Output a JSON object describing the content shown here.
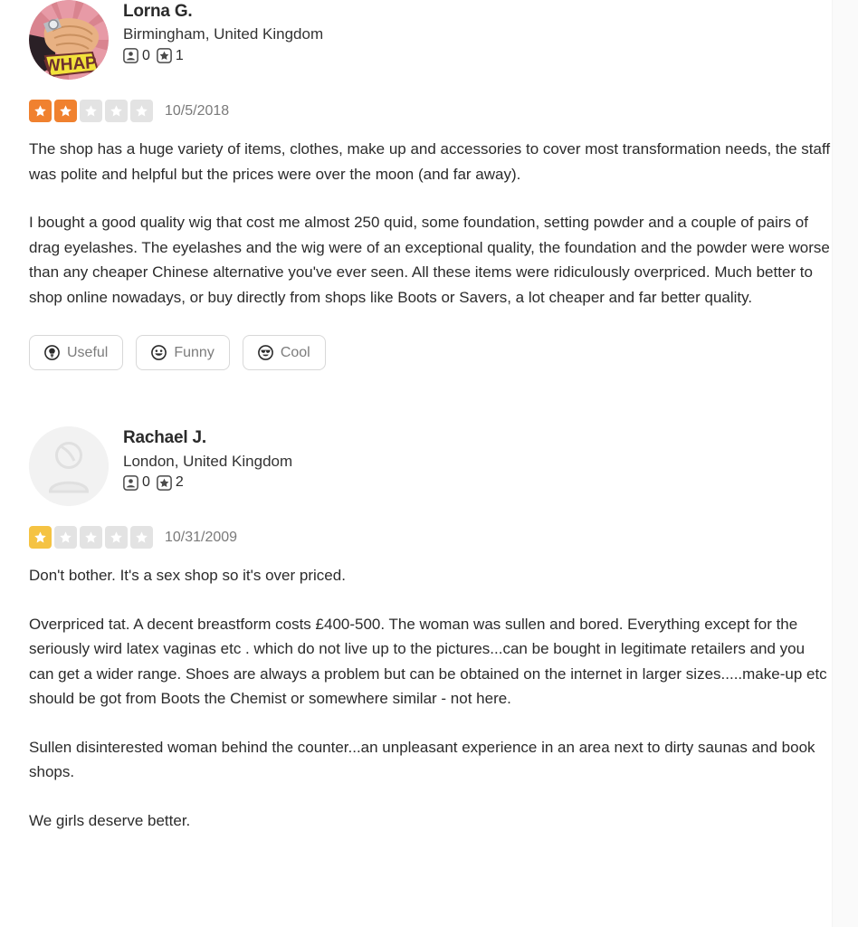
{
  "reviews": [
    {
      "user": {
        "name": "Lorna G.",
        "location": "Birmingham, United Kingdom",
        "friends_icon": "friends-icon",
        "friends_count": "0",
        "reviews_icon": "reviews-star-icon",
        "reviews_count": "1",
        "avatar_type": "photo-whap-comic",
        "avatar_caption": "WHAP"
      },
      "rating": 2,
      "rating_color": "#f0812f",
      "date": "10/5/2018",
      "paragraphs": [
        "The shop has a huge variety of items, clothes, make up and accessories to cover most transformation needs, the staff was polite and helpful but the prices were over the moon (and far away).",
        "I bought a good quality wig that cost me almost 250 quid, some foundation, setting powder and a couple of pairs of drag eyelashes. The eyelashes and the wig were of an exceptional quality, the foundation and the powder were worse than any cheaper Chinese alternative you've ever seen. All these items were ridiculously overpriced. Much better to shop online nowadays, or buy directly from shops like Boots or Savers, a lot cheaper and far better quality."
      ],
      "actions": [
        {
          "label": "Useful",
          "icon": "lightbulb-icon"
        },
        {
          "label": "Funny",
          "icon": "smiley-laugh-icon"
        },
        {
          "label": "Cool",
          "icon": "smiley-sunglasses-icon"
        }
      ]
    },
    {
      "user": {
        "name": "Rachael J.",
        "location": "London, United Kingdom",
        "friends_icon": "friends-icon",
        "friends_count": "0",
        "reviews_icon": "reviews-star-icon",
        "reviews_count": "2",
        "avatar_type": "default-placeholder",
        "avatar_caption": ""
      },
      "rating": 1,
      "rating_color": "#f5c343",
      "date": "10/31/2009",
      "paragraphs": [
        "Don't bother. It's a sex shop so it's over priced.",
        "Overpriced tat. A decent breastform costs £400-500. The woman was sullen and bored. Everything except for the seriously wird latex vaginas etc .  which do not live up to the pictures...can be bought in legitimate retailers and you can get a wider range. Shoes are always a problem but can be obtained on the internet in larger sizes.....make-up etc should be got from Boots the Chemist or somewhere similar - not here.",
        "Sullen disinterested woman behind the counter...an unpleasant experience in an area next to dirty saunas and book shops.",
        "We girls deserve better."
      ],
      "actions": []
    }
  ],
  "colors": {
    "star_filled_two": "#f0812f",
    "star_filled_one": "#f5c343",
    "star_empty": "#e3e3e3",
    "text_primary": "#2b2b2b",
    "text_muted": "#7a7a7a",
    "page_background": "#ffffff"
  }
}
